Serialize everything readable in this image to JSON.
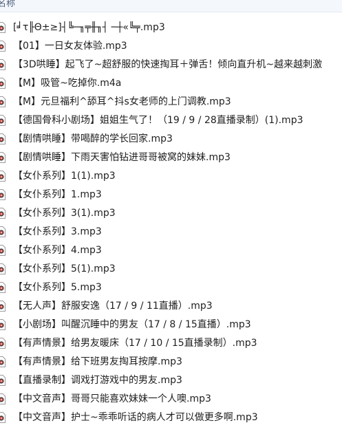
{
  "header": {
    "name_column": "名称"
  },
  "files": [
    {
      "name": "[╛τ╟Θ±≥]┤╚─╖╤╫╖┤ ─┼«╚╤.mp3"
    },
    {
      "name": "【01】一日女友体验.mp3"
    },
    {
      "name": "【3D哄睡】起飞了~超舒服的快速掏耳＋弹舌！倾向直升机~越来越刺激"
    },
    {
      "name": "【M】吸管~吃掉你.m4a"
    },
    {
      "name": "【M】元旦福利^舔耳^抖s女老师的上门调教.mp3"
    },
    {
      "name": "【德国骨科小剧场】姐姐生气了！（19 / 9 / 28直播录制）(1).mp3"
    },
    {
      "name": "【剧情哄睡】带喝醉的学长回家.mp3"
    },
    {
      "name": "【剧情哄睡】下雨天害怕钻进哥哥被窝的妹妹.mp3"
    },
    {
      "name": "【女仆系列】1(1).mp3"
    },
    {
      "name": "【女仆系列】1.mp3"
    },
    {
      "name": "【女仆系列】3(1).mp3"
    },
    {
      "name": "【女仆系列】3.mp3"
    },
    {
      "name": "【女仆系列】4.mp3"
    },
    {
      "name": "【女仆系列】5(1).mp3"
    },
    {
      "name": "【女仆系列】5.mp3"
    },
    {
      "name": "【无人声】舒服安逸（17 / 9 / 11直播）.mp3"
    },
    {
      "name": "【小剧场】叫醒沉睡中的男友（17 / 8 / 15直播）.mp3"
    },
    {
      "name": "【有声情景】给男友暖床（17 / 10 / 15直播录制）.mp3"
    },
    {
      "name": "【有声情景】给下班男友掏耳按摩.mp3"
    },
    {
      "name": "【直播录制】调戏打游戏中的男友.mp3"
    },
    {
      "name": "【中文音声】哥哥只能喜欢妹妹一个人噢.mp3"
    },
    {
      "name": "【中文音声】护士~乖乖听话的病人才可以做更多啊.mp3"
    }
  ],
  "icons": {
    "file": "audio-file-icon"
  }
}
